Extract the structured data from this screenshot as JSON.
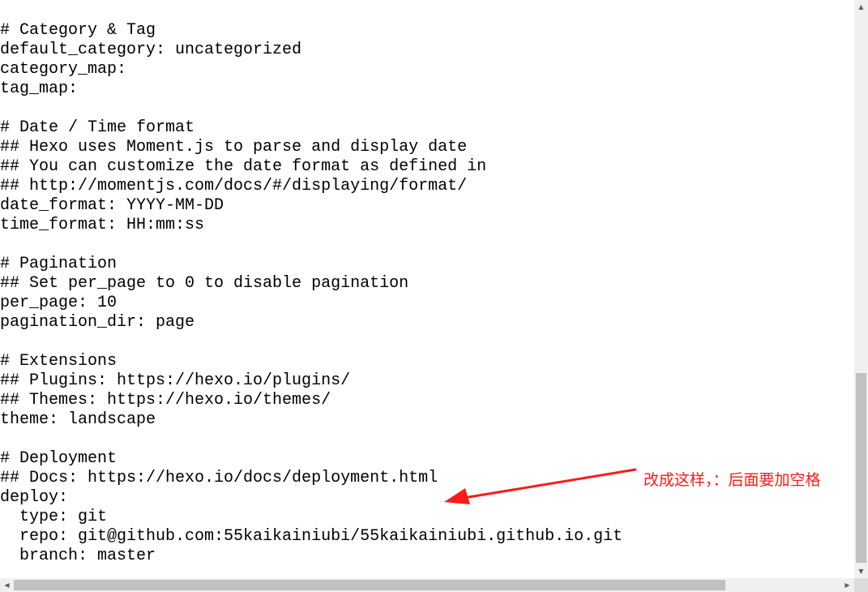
{
  "colors": {
    "background": "#ffffff",
    "text": "#000000",
    "annotation": "#ff1a1a",
    "scrollbar_track": "#f0f0f0",
    "scrollbar_thumb": "#c1c1c1"
  },
  "editor": {
    "lines": [
      "# Category & Tag",
      "default_category: uncategorized",
      "category_map:",
      "tag_map:",
      "",
      "# Date / Time format",
      "## Hexo uses Moment.js to parse and display date",
      "## You can customize the date format as defined in",
      "## http://momentjs.com/docs/#/displaying/format/",
      "date_format: YYYY-MM-DD",
      "time_format: HH:mm:ss",
      "",
      "# Pagination",
      "## Set per_page to 0 to disable pagination",
      "per_page: 10",
      "pagination_dir: page",
      "",
      "# Extensions",
      "## Plugins: https://hexo.io/plugins/",
      "## Themes: https://hexo.io/themes/",
      "theme: landscape",
      "",
      "# Deployment",
      "## Docs: https://hexo.io/docs/deployment.html",
      "deploy:",
      "  type: git",
      "  repo: git@github.com:55kaikainiubi/55kaikainiubi.github.io.git",
      "  branch: master"
    ]
  },
  "annotation": {
    "text": "改成这样，：后面要加空格"
  },
  "scrollbars": {
    "vertical": {
      "up_icon": "▲",
      "down_icon": "▼"
    },
    "horizontal": {
      "left_icon": "◀",
      "right_icon": "▶"
    }
  }
}
